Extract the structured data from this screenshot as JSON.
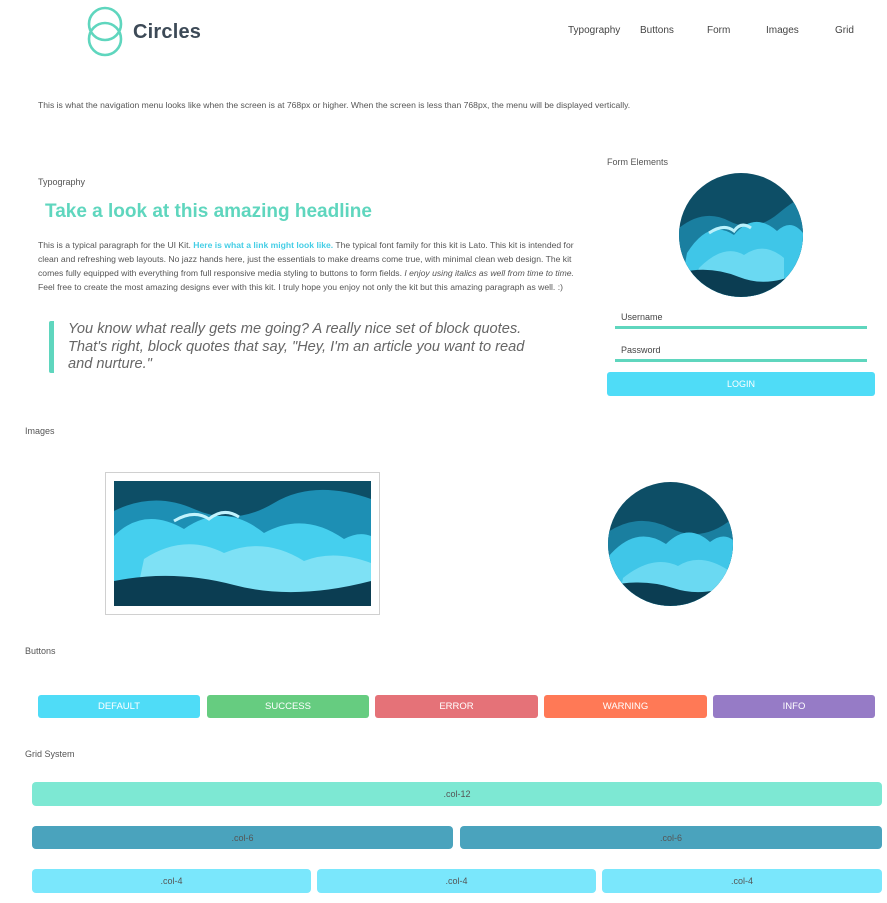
{
  "brand": {
    "name": "Circles"
  },
  "nav": [
    "Typography",
    "Buttons",
    "Form",
    "Images",
    "Grid"
  ],
  "intro": "This is what the navigation menu looks like when the screen is at 768px or higher. When the screen is less than 768px, the menu will be displayed vertically.",
  "typography": {
    "label": "Typography",
    "headline": "Take a look at this amazing headline",
    "para_1": "This is a typical paragraph for the UI Kit. ",
    "link": "Here is what a link might look like.",
    "para_2": " The typical font family for this kit is Lato. This kit is intended for clean and refreshing web layouts. No jazz hands here, just the essentials to make dreams come true, with minimal clean web design. The kit comes fully equipped with everything from full responsive media styling to buttons to form fields. ",
    "italic": "I enjoy using italics as well from time to time.",
    "para_3": " Feel free to create the most amazing designs ever with this kit. I truly hope you enjoy not only the kit but this amazing paragraph as well. :)",
    "quote": "You know what really gets me going? A really nice set of block quotes. That's right, block quotes that say, \"Hey, I'm an article you want to read and nurture.\""
  },
  "form": {
    "label": "Form Elements",
    "username_placeholder": "Username",
    "password_placeholder": "Password",
    "login": "LOGIN"
  },
  "images": {
    "label": "Images"
  },
  "buttons": {
    "label": "Buttons",
    "items": [
      {
        "label": "DEFAULT",
        "color": "#4fdcf7"
      },
      {
        "label": "SUCCESS",
        "color": "#66cc80"
      },
      {
        "label": "ERROR",
        "color": "#e57278"
      },
      {
        "label": "WARNING",
        "color": "#ff7956"
      },
      {
        "label": "INFO",
        "color": "#967bc6"
      }
    ]
  },
  "grid": {
    "label": "Grid System",
    "col12": ".col-12",
    "col6": ".col-6",
    "col4": ".col-4",
    "colors": {
      "col12": "#7de8d3",
      "col6": "#4aa3bd",
      "col4": "#7ae7fc"
    }
  },
  "colors": {
    "accent": "#5fd6be",
    "link": "#45cee6",
    "primary": "#4fdcf7"
  }
}
